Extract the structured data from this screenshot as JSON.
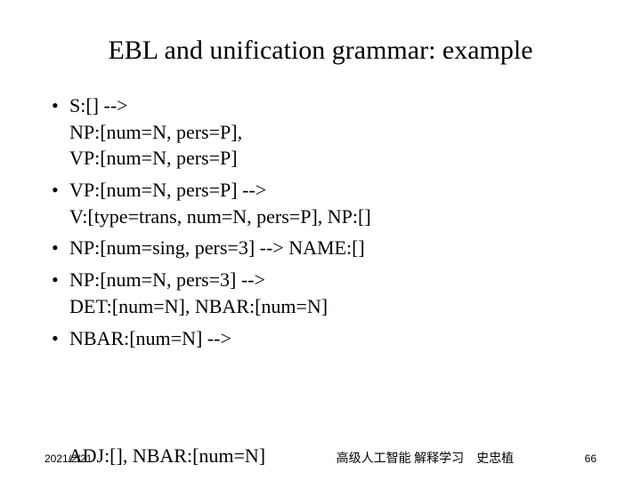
{
  "title": "EBL and unification grammar: example",
  "bullets": [
    "S:[] -->\nNP:[num=N, pers=P],\nVP:[num=N, pers=P]",
    "VP:[num=N, pers=P] -->\nV:[type=trans, num=N, pers=P], NP:[]",
    "NP:[num=sing, pers=3] --> NAME:[]",
    "NP:[num=N, pers=3] -->\nDET:[num=N], NBAR:[num=N]",
    "NBAR:[num=N] -->"
  ],
  "footer": {
    "date": "2021/2/21",
    "overlap": "ADJ:[], NBAR:[num=N]",
    "mid": "高级人工智能 解释学习　史忠植",
    "page": "66"
  }
}
